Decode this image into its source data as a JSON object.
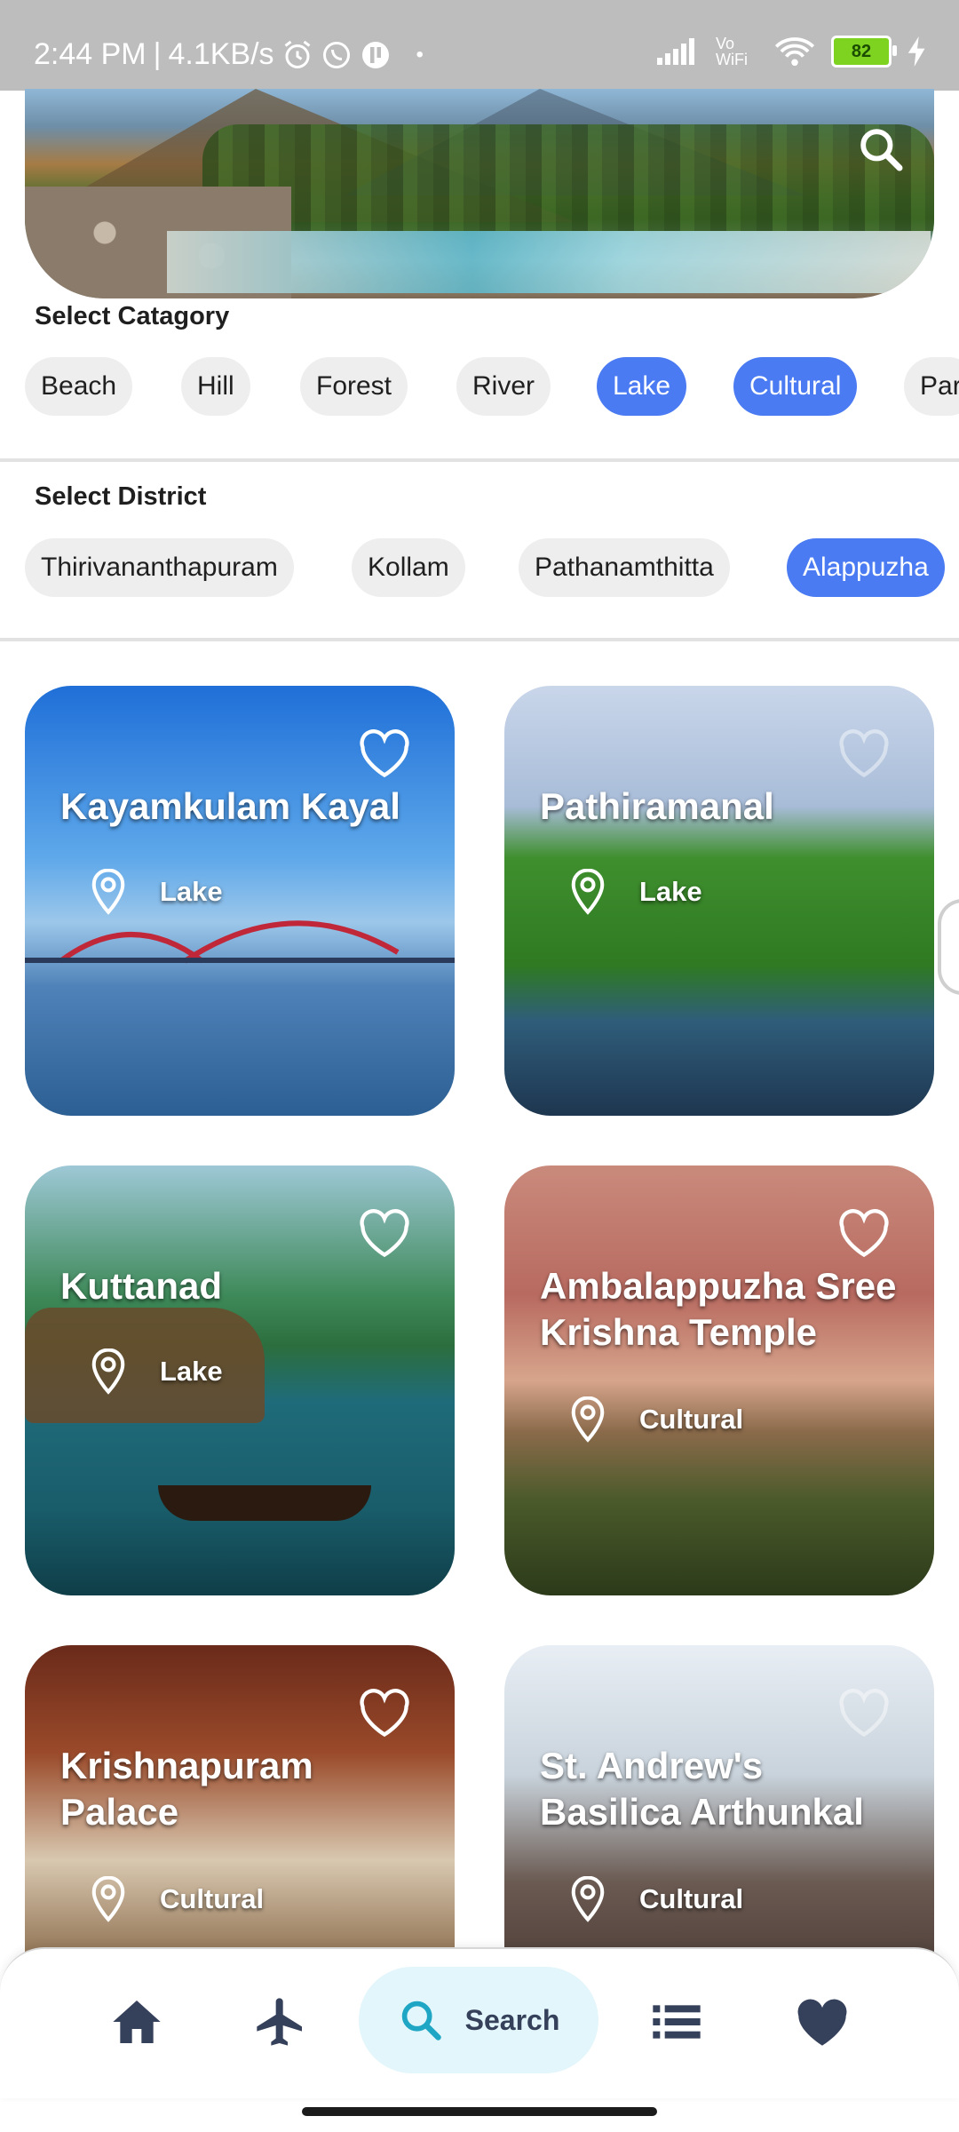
{
  "status_bar": {
    "time": "2:44 PM",
    "net_speed": "4.1KB/s",
    "vowifi": "Vo WiFi",
    "battery": "82"
  },
  "category": {
    "label": "Select Catagory",
    "chips": [
      "Beach",
      "Hill",
      "Forest",
      "River",
      "Lake",
      "Cultural",
      "Par"
    ]
  },
  "district": {
    "label": "Select District",
    "chips": [
      "Thirivananthapuram",
      "Kollam",
      "Pathanamthitta",
      "Alappuzha"
    ]
  },
  "places": [
    {
      "title": "Kayamkulam Kayal",
      "category": "Lake",
      "favorite": true
    },
    {
      "title": "Pathiramanal",
      "category": "Lake",
      "favorite": false
    },
    {
      "title": "Kuttanad",
      "category": "Lake",
      "favorite": true
    },
    {
      "title": "Ambalappuzha Sree Krishna Temple",
      "category": "Cultural",
      "favorite": true
    },
    {
      "title": "Krishnapuram Palace",
      "category": "Cultural",
      "favorite": true
    },
    {
      "title": "St. Andrew's Basilica Arthunkal",
      "category": "Cultural",
      "favorite": false
    }
  ],
  "bottom_nav": {
    "items": [
      "home-icon",
      "airplane-icon",
      "search-icon",
      "list-icon",
      "heart-icon"
    ],
    "search_label": "Search"
  },
  "colors": {
    "accent": "#4a7bf2",
    "nav_search_bg": "#e3f6fb",
    "nav_icon": "#35405a"
  }
}
